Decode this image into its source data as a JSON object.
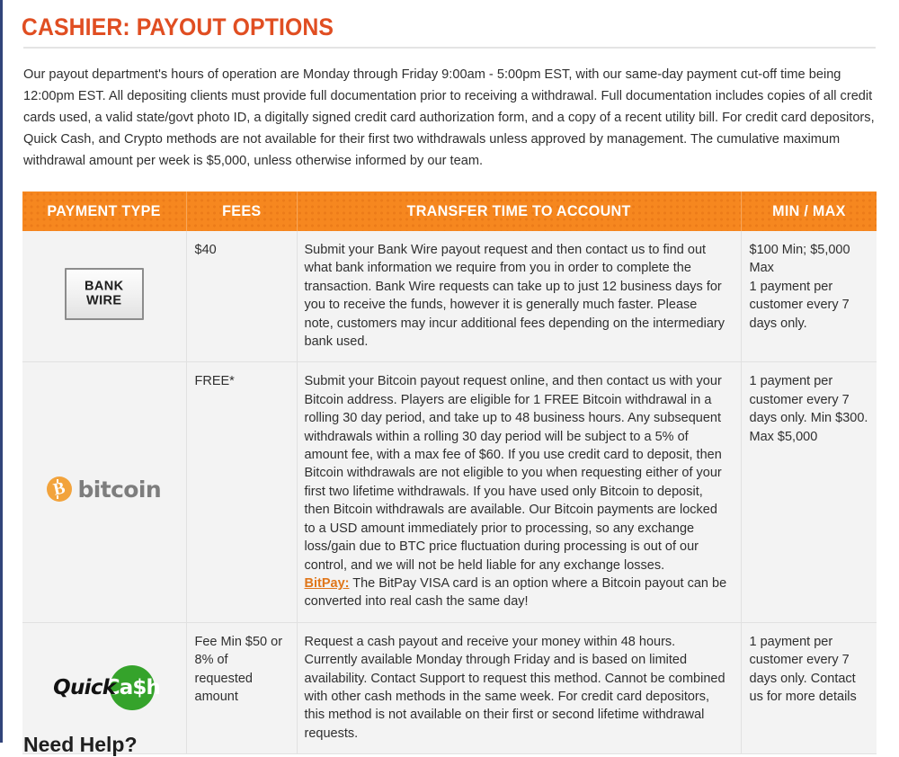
{
  "page": {
    "title": "CASHIER: PAYOUT OPTIONS",
    "intro": "Our payout department's hours of operation are Monday through Friday 9:00am - 5:00pm EST, with our same-day payment cut-off time being 12:00pm EST. All depositing clients must provide full documentation prior to receiving a withdrawal. Full documentation includes copies of all credit cards used, a valid state/govt photo ID, a digitally signed credit card authorization form, and a copy of a recent utility bill. For credit card depositors, Quick Cash, and Crypto methods are not available for their first two withdrawals unless approved by management. The cumulative maximum withdrawal amount per week is $5,000, unless otherwise informed by our team.",
    "footer_teaser": "Need Help?",
    "accent_color": "#e04e22",
    "header_color": "#f6871f",
    "link_color": "#e0761a"
  },
  "table": {
    "headers": [
      "PAYMENT TYPE",
      "FEES",
      "TRANSFER TIME TO ACCOUNT",
      "MIN / MAX"
    ],
    "rows": [
      {
        "logo": "bank-wire-logo",
        "logo_line1": "BANK",
        "logo_line2": "WIRE",
        "fees": "$40",
        "transfer_time": "Submit your Bank Wire payout request and then contact us to find out what bank information we require from you in order to complete the transaction. Bank Wire requests can take up to just 12 business days for you to receive the funds, however it is generally much faster. Please note, customers may incur additional fees depending on the intermediary bank used.",
        "min_max": "$100 Min; $5,000 Max\n1 payment per customer every 7 days only."
      },
      {
        "logo": "bitcoin-logo",
        "logo_word": "bitcoin",
        "logo_symbol": "B",
        "fees": "FREE*",
        "transfer_time": "Submit your Bitcoin payout request online, and then contact us with your Bitcoin address. Players are eligible for 1 FREE Bitcoin withdrawal in a rolling 30 day period, and take up to 48 business hours. Any subsequent withdrawals within a rolling 30 day period will be subject to a 5% of amount fee, with a max fee of $60. If you use credit card to deposit, then Bitcoin withdrawals are not eligible to you when requesting either of your first two lifetime withdrawals. If you have used only Bitcoin to deposit, then Bitcoin withdrawals are available. Our Bitcoin payments are locked to a USD amount immediately prior to processing, so any exchange loss/gain due to BTC price fluctuation during processing is out of our control, and we will not be held liable for any exchange losses.",
        "transfer_time_link_label": "BitPay:",
        "transfer_time_extra": " The BitPay VISA card is an option where a Bitcoin payout can be converted into real cash the same day!",
        "min_max": "1 payment per customer every 7 days only. Min $300. Max $5,000"
      },
      {
        "logo": "quick-cash-logo",
        "logo_word1": "Quick",
        "logo_word2": "Ca$h",
        "fees": "Fee Min $50 or 8% of requested amount",
        "transfer_time": "Request a cash payout and receive your money within 48 hours. Currently available Monday through Friday and is based on limited availability. Contact Support to request this method. Cannot be combined with other cash methods in the same week. For credit card depositors, this method is not available on their first or second lifetime withdrawal requests.",
        "min_max": "1 payment per customer every 7 days only. Contact us for more details"
      }
    ]
  }
}
